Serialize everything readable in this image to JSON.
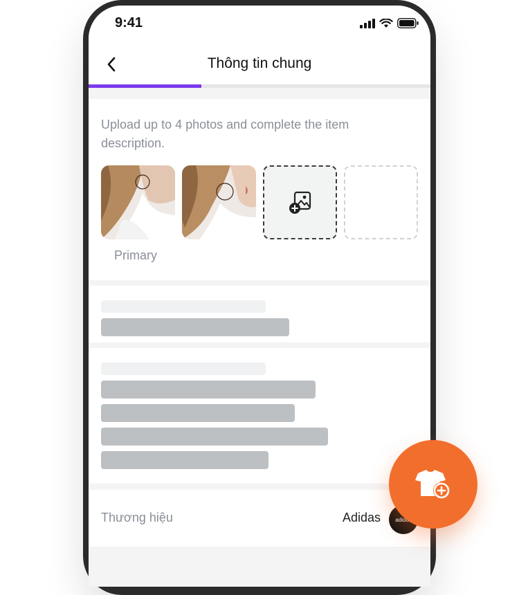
{
  "status_bar": {
    "time": "9:41"
  },
  "header": {
    "title": "Thông tin chung"
  },
  "progress": {
    "fraction": 0.33,
    "color": "#7c3aed"
  },
  "photos_section": {
    "hint": "Upload up to 4 photos and complete the item description.",
    "primary_label": "Primary",
    "slots": [
      "photo",
      "photo",
      "add-photo",
      "empty"
    ]
  },
  "brand": {
    "label": "Thương hiệu",
    "value": "Adidas",
    "logo_text": "adidas"
  },
  "fab": {
    "icon": "add-clothing-icon",
    "color": "#f26e2c"
  },
  "icons": {
    "back": "chevron-left-icon",
    "add_photo": "add-photo-icon",
    "signal": "signal-icon",
    "wifi": "wifi-icon",
    "battery": "battery-icon"
  }
}
